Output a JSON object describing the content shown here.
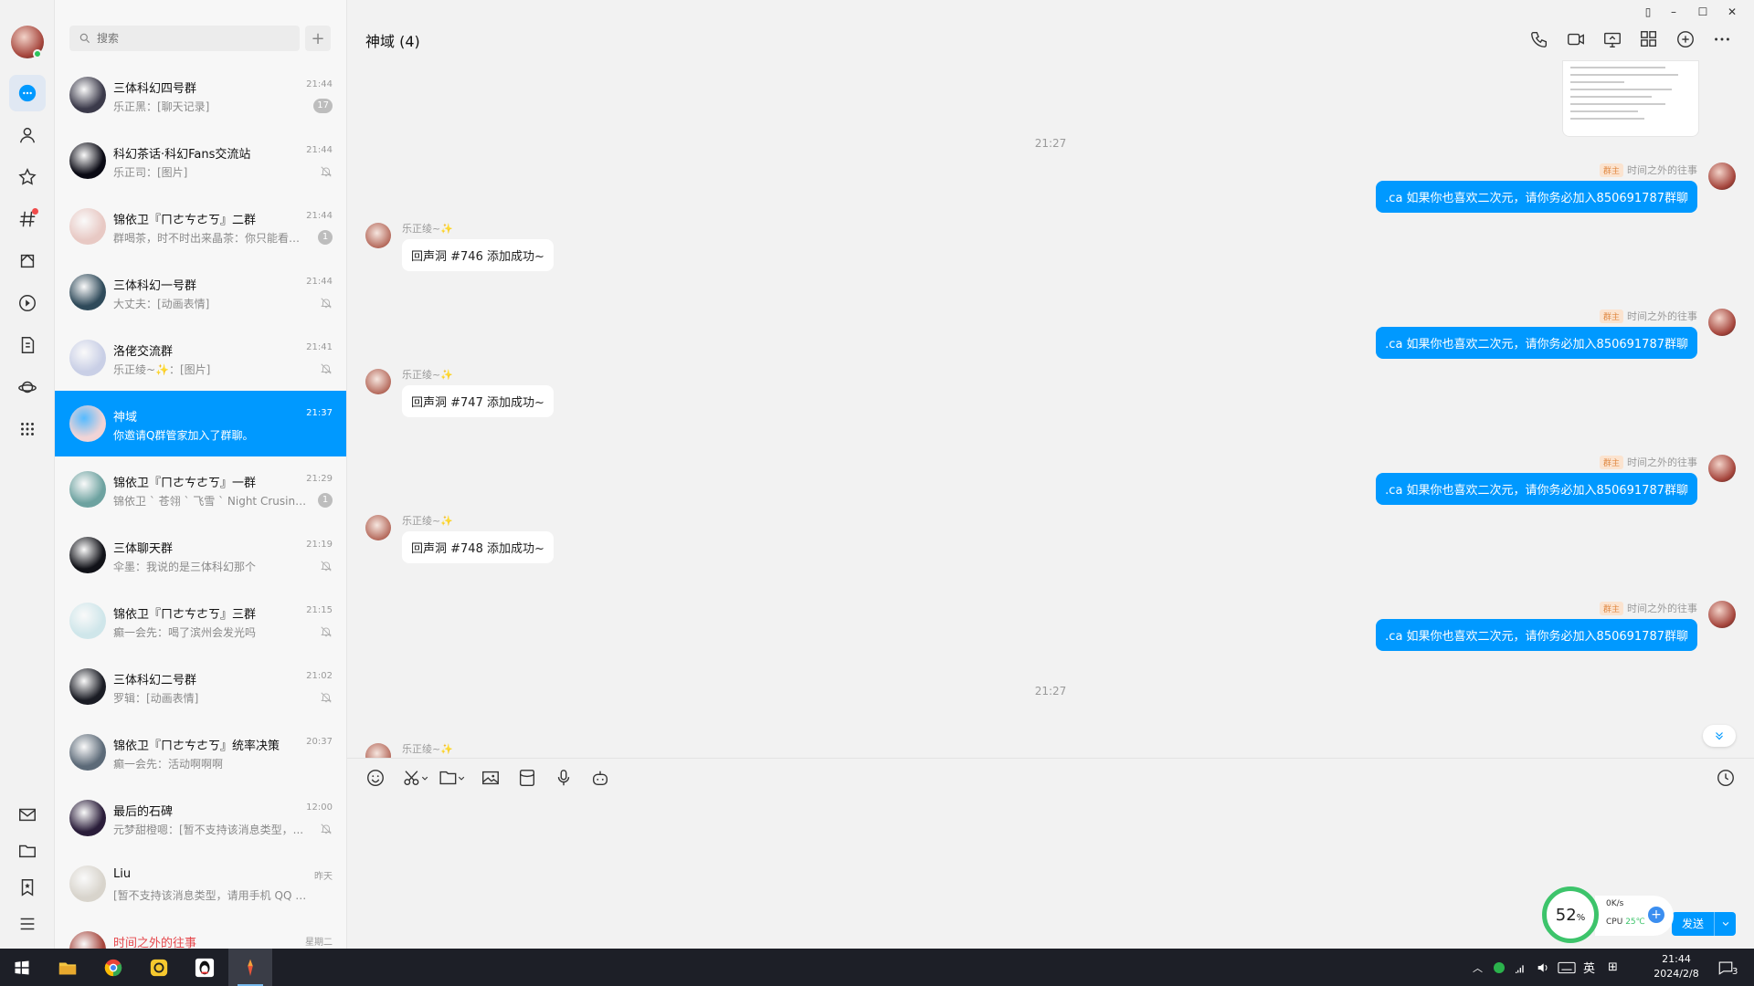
{
  "app": {
    "accent": "#0099ff"
  },
  "search": {
    "placeholder": "搜索"
  },
  "conversations": [
    {
      "name": "三体科幻四号群",
      "preview": "乐正黑：[聊天记录]",
      "time": "21:44",
      "badge": "17",
      "muted": false,
      "avatar_color": "#3b3a4a"
    },
    {
      "name": "科幻茶话·科幻Fans交流站",
      "preview": "乐正司：[图片]",
      "time": "21:44",
      "badge": "",
      "muted": true,
      "avatar_color": "#0a0a14"
    },
    {
      "name": "锦依卫『ㄇㄜㄘㄜㄎ』二群",
      "preview": "群喝茶，时不时出来晶茶：你只能看见...",
      "time": "21:44",
      "badge": "1",
      "muted": false,
      "avatar_color": "#e8c9c4"
    },
    {
      "name": "三体科幻一号群",
      "preview": "大丈夫：[动画表情]",
      "time": "21:44",
      "badge": "",
      "muted": true,
      "avatar_color": "#2f4a5a"
    },
    {
      "name": "洛佬交流群",
      "preview": "乐正绫~✨：[图片]",
      "time": "21:41",
      "badge": "",
      "muted": true,
      "avatar_color": "#c9cfe6"
    },
    {
      "name": "神域",
      "preview": "你邀请Q群管家加入了群聊。",
      "time": "21:37",
      "badge": "",
      "muted": false,
      "avatar_color": "#f1d4d6"
    },
    {
      "name": "锦依卫『ㄇㄜㄘㄜㄎ』一群",
      "preview": "锦依卫 ` 苍翎 ` 飞雪 ` Night Crusing...",
      "time": "21:29",
      "badge": "1",
      "muted": false,
      "avatar_color": "#6da2a0"
    },
    {
      "name": "三体聊天群",
      "preview": "伞墨：我说的是三体科幻那个",
      "time": "21:19",
      "badge": "",
      "muted": true,
      "avatar_color": "#111218"
    },
    {
      "name": "锦依卫『ㄇㄜㄘㄜㄎ』三群",
      "preview": "癫一会先：喝了滨州会发光吗",
      "time": "21:15",
      "badge": "",
      "muted": true,
      "avatar_color": "#cfe6ea"
    },
    {
      "name": "三体科幻二号群",
      "preview": "罗辑：[动画表情]",
      "time": "21:02",
      "badge": "",
      "muted": true,
      "avatar_color": "#1a1c24"
    },
    {
      "name": "锦依卫『ㄇㄜㄘㄜㄎ』统率决策",
      "preview": "癫一会先：活动啊啊啊",
      "time": "20:37",
      "badge": "",
      "muted": false,
      "avatar_color": "#5c6a78"
    },
    {
      "name": "最后的石碑",
      "preview": "元梦甜橙嗯：[暂不支持该消息类型，...",
      "time": "12:00",
      "badge": "",
      "muted": true,
      "avatar_color": "#2a1d3a"
    },
    {
      "name": "Liu",
      "preview": "[暂不支持该消息类型，请用手机 QQ 查看]",
      "time": "昨天",
      "badge": "",
      "muted": false,
      "avatar_color": "#d8d4cc"
    },
    {
      "name": "时间之外的往事",
      "preview": "",
      "time": "星期二",
      "badge": "",
      "muted": false,
      "avatar_color": "#a5453c"
    }
  ],
  "chat": {
    "title": "神域 (4)",
    "time_sep_1": "21:27",
    "time_sep_2": "21:27",
    "incoming": [
      {
        "sender": "乐正绫~✨",
        "text": "回声洞 #746 添加成功~"
      },
      {
        "sender": "乐正绫~✨",
        "text": "回声洞 #747 添加成功~"
      },
      {
        "sender": "乐正绫~✨",
        "text": "回声洞 #748 添加成功~"
      },
      {
        "sender": "乐正绫~✨",
        "text": ""
      }
    ],
    "outgoing": [
      {
        "role": "群主",
        "sender": "时间之外的往事",
        "text": ".ca 如果你也喜欢二次元，请你务必加入850691787群聊"
      },
      {
        "role": "群主",
        "sender": "时间之外的往事",
        "text": ".ca 如果你也喜欢二次元，请你务必加入850691787群聊"
      },
      {
        "role": "群主",
        "sender": "时间之外的往事",
        "text": ".ca 如果你也喜欢二次元，请你务必加入850691787群聊"
      },
      {
        "role": "群主",
        "sender": "时间之外的往事",
        "text": ".ca 如果你也喜欢二次元，请你务必加入850691787群聊"
      }
    ]
  },
  "composer": {
    "send_label": "发送"
  },
  "perf": {
    "percent": "52",
    "percent_unit": "%",
    "speed": "0K/s",
    "cpu_label": "CPU",
    "cpu_temp": "25℃"
  },
  "taskbar": {
    "lang": "英",
    "time": "21:44",
    "date": "2024/2/8",
    "notif": "3"
  }
}
